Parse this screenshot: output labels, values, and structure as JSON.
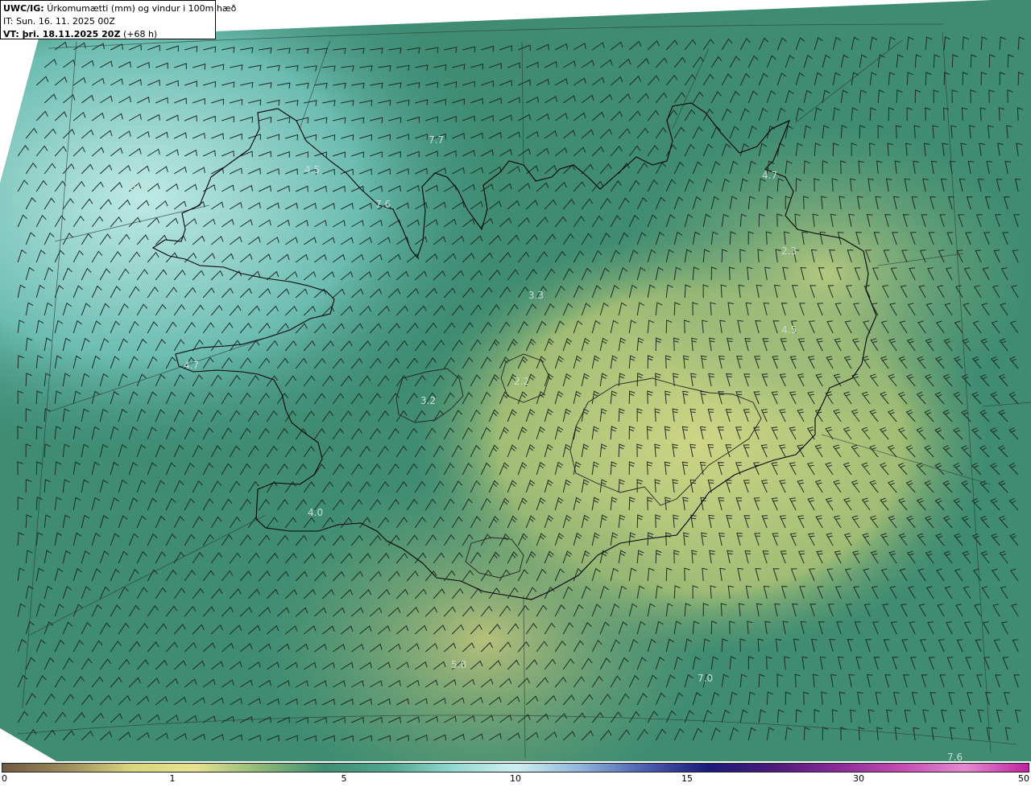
{
  "header": {
    "model_label": "UWC/IG:",
    "title": "Úrkomumætti (mm) og vindur i 100m hæð",
    "it_label": "IT:",
    "it_value": "Sun. 16. 11. 2025 00Z",
    "vt_label": "VT: þri. 18.11.2025 20Z",
    "vt_lead": "(+68 h)"
  },
  "map_labels": [
    "7.7",
    "4.5",
    "10.3",
    "7.6",
    "4.7",
    "2.3",
    "3.3",
    "4.5",
    "4.7",
    "3.2",
    "2.2",
    "4.0",
    "5.8",
    "7.0",
    "7.6"
  ],
  "colorbar": {
    "ticks": [
      "0",
      "1",
      "5",
      "10",
      "15",
      "30",
      "50"
    ],
    "colors": [
      "#6f5a43",
      "#9c8c5a",
      "#d8d57e",
      "#e7e28e",
      "#8fba78",
      "#3e8f72",
      "#4ea48c",
      "#8ed9d0",
      "#cfeff0",
      "#8fb7dc",
      "#4c5fb0",
      "#1a1a7a",
      "#4a1a7a",
      "#8a2a9a",
      "#c44ab0",
      "#e48ad0",
      "#c020a0"
    ]
  }
}
